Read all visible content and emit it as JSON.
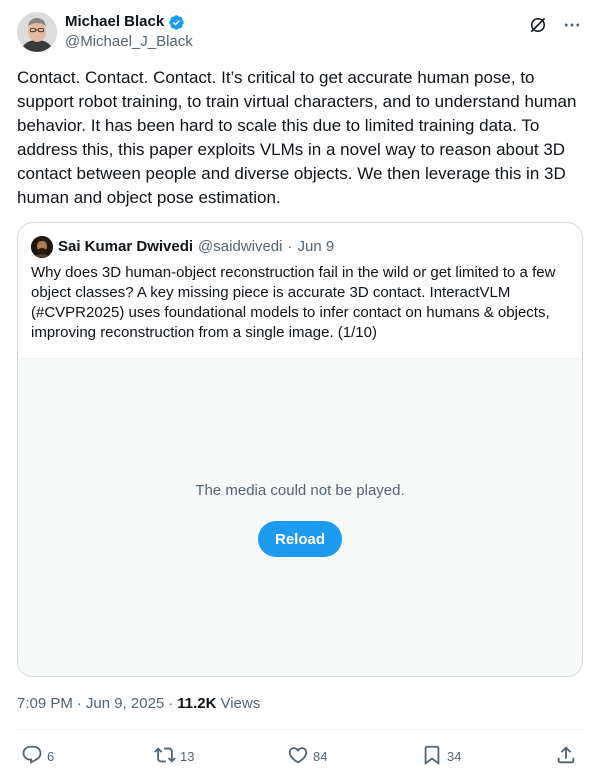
{
  "author": {
    "display_name": "Michael Black",
    "handle": "@Michael_J_Black",
    "verified_color": "#1d9bf0"
  },
  "tweet": {
    "text": "Contact. Contact. Contact. It’s critical to get accurate human pose, to support robot training, to train virtual characters, and to understand human behavior. It has been hard to scale this due to limited training data. To address this, this paper exploits VLMs in a novel way to reason about 3D contact between people and diverse objects. We then leverage this in 3D human and object pose estimation."
  },
  "quote": {
    "display_name": "Sai Kumar Dwivedi",
    "handle": "@saidwivedi",
    "separator": "·",
    "date": "Jun 9",
    "text": "Why does 3D human-object reconstruction fail in the wild or get limited to a few object classes? A key missing piece is accurate 3D contact. InteractVLM (#CVPR2025) uses foundational models to infer contact on humans & objects, improving reconstruction from a single image. (1/10)",
    "media_message": "The media could not be played.",
    "reload_label": "Reload"
  },
  "meta": {
    "time": "7:09 PM",
    "separator": "·",
    "date": "Jun 9, 2025",
    "views_count": "11.2K",
    "views_label": "Views"
  },
  "actions": {
    "replies": "6",
    "reposts": "13",
    "likes": "84",
    "bookmarks": "34"
  },
  "colors": {
    "text": "#0f1419",
    "muted": "#536471",
    "accent": "#1d9bf0",
    "border": "#cfd9de"
  },
  "icons": {
    "grok": "grok-icon",
    "more": "more-icon",
    "reply": "reply-icon",
    "repost": "repost-icon",
    "like": "like-icon",
    "bookmark": "bookmark-icon",
    "share": "share-icon"
  }
}
